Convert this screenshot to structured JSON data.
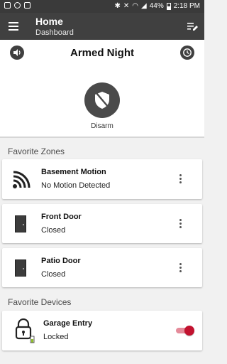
{
  "status_bar": {
    "battery_percent": "44%",
    "time": "2:18 PM",
    "left_icons": [
      "home-icon",
      "at-icon",
      "image-icon"
    ],
    "right_icons": [
      "bluetooth-icon",
      "mute-icon",
      "wifi-icon",
      "signal-icon",
      "battery-icon"
    ]
  },
  "app_bar": {
    "title": "Home",
    "subtitle": "Dashboard",
    "menu_icon": "menu-icon",
    "edit_icon": "edit-list-icon"
  },
  "security_panel": {
    "state": "Armed Night",
    "action_label": "Disarm",
    "left_icon": "speaker-icon",
    "right_icon": "clock-icon",
    "action_icon": "shield-off-icon"
  },
  "favorite_zones": {
    "header": "Favorite Zones",
    "items": [
      {
        "name": "Basement Motion",
        "status": "No Motion Detected",
        "icon": "motion-sensor-icon"
      },
      {
        "name": "Front Door",
        "status": "Closed",
        "icon": "door-icon"
      },
      {
        "name": "Patio Door",
        "status": "Closed",
        "icon": "door-icon"
      }
    ]
  },
  "favorite_devices": {
    "header": "Favorite Devices",
    "items": [
      {
        "name": "Garage Entry",
        "status": "Locked",
        "icon": "lock-icon",
        "toggle_on": true
      }
    ]
  },
  "colors": {
    "app_bar": "#404040",
    "accent_toggle": "#c2122f",
    "background": "#f1f1f1"
  }
}
